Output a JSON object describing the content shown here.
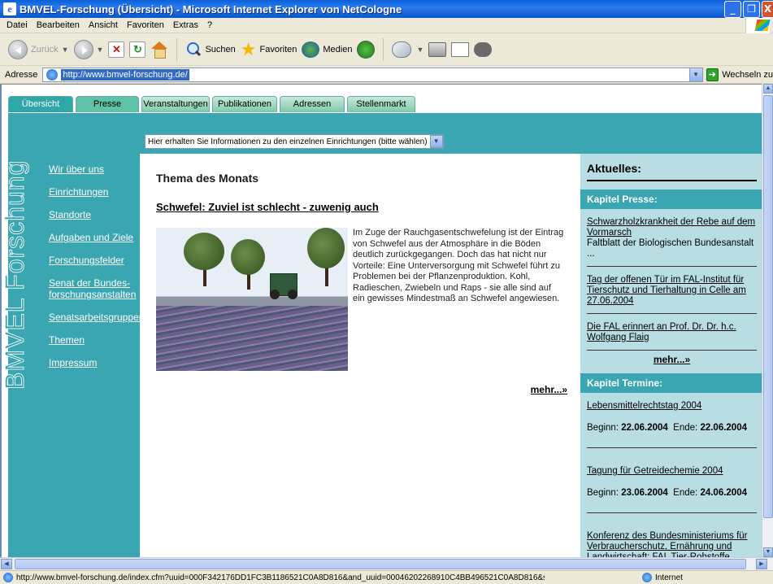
{
  "window": {
    "title": "BMVEL-Forschung (Übersicht) - Microsoft Internet Explorer von NetCologne",
    "minimize": "_",
    "maximize": "❐",
    "close": "X"
  },
  "menu": [
    "Datei",
    "Bearbeiten",
    "Ansicht",
    "Favoriten",
    "Extras",
    "?"
  ],
  "toolbar": {
    "back": "Zurück",
    "search": "Suchen",
    "favorites": "Favoriten",
    "media": "Medien"
  },
  "address": {
    "label": "Adresse",
    "url": "http://www.bmvel-forschung.de/",
    "go": "Wechseln zu"
  },
  "tabs": [
    "Übersicht",
    "Presse",
    "Veranstaltungen",
    "Publikationen",
    "Adressen",
    "Stellenmarkt"
  ],
  "select": {
    "value": "Hier erhalten Sie Informationen zu den einzelnen Einrichtungen (bitte wählen)"
  },
  "brand": "BMVEL Forschung",
  "nav": [
    "Wir über uns",
    "Einrichtungen",
    "Standorte",
    "Aufgaben und Ziele",
    "Forschungsfelder",
    "Senat der Bundes-forschungsanstalten",
    "Senatsarbeitsgruppen",
    "Themen",
    "Impressum"
  ],
  "main": {
    "section_title": "Thema des Monats",
    "article_title": "Schwefel: Zuviel ist schlecht - zuwenig auch",
    "article_text": "Im Zuge der Rauchgasentschwefelung ist der Eintrag von Schwefel aus der Atmosphäre in die Böden deutlich zurückgegangen. Doch das hat nicht nur Vorteile: Eine Unterversorgung mit Schwefel führt zu Problemen bei der Pflanzenproduktion. Kohl, Radieschen, Zwiebeln und Raps - sie alle sind auf ein gewisses Mindestmaß an Schwefel angewiesen.",
    "more": "mehr...»"
  },
  "aside": {
    "title": "Aktuelles:",
    "press_head": "Kapitel Presse:",
    "press": [
      {
        "link": "Schwarzholzkrankheit der Rebe auf dem Vormarsch",
        "text": "Faltblatt der Biologischen Bundesanstalt ..."
      },
      {
        "link": "Tag der offenen Tür im FAL-Institut für Tierschutz und Tierhaltung in Celle am 27.06.2004",
        "text": ""
      },
      {
        "link": "Die FAL erinnert an Prof. Dr. Dr. h.c. Wolfgang Flaig",
        "text": ""
      }
    ],
    "press_more": "mehr...»",
    "terms_head": "Kapitel Termine:",
    "terms": [
      {
        "title": "Lebensmittelrechtstag 2004",
        "begin_label": "Beginn:",
        "begin": "22.06.2004",
        "end_label": "Ende:",
        "end": "22.06.2004"
      },
      {
        "title": "Tagung für Getreidechemie 2004",
        "begin_label": "Beginn:",
        "begin": "23.06.2004",
        "end_label": "Ende:",
        "end": "24.06.2004"
      }
    ],
    "term_partial": "Konferenz des Bundesministeriums für Verbraucherschutz, Ernährung und Landwirtschaft: FAL Tier-Rohstoffe"
  },
  "status": {
    "url": "http://www.bmvel-forschung.de/index.cfm?uuid=000F342176DD1FC3B1186521C0A8D816&and_uuid=00046202268910C4BB496521C0A8D816&sho",
    "zone": "Internet"
  },
  "colors": {
    "teal": "#3aa6b1",
    "aside_bg": "#b8dde3",
    "titlebar": "#0a5fd8"
  }
}
